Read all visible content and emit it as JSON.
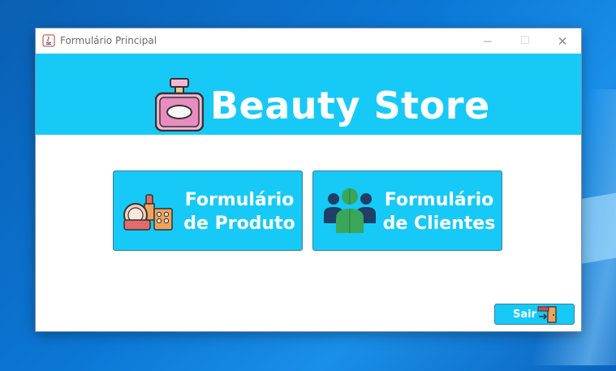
{
  "window": {
    "title": "Formulário Principal",
    "minimize": "—",
    "maximize": "☐",
    "close": "✕"
  },
  "header": {
    "title": "Beauty Store",
    "logo_icon": "perfume-bottle-icon"
  },
  "buttons": {
    "produto": {
      "line1": "Formulário",
      "line2": "de Produto",
      "icon": "makeup-kit-icon"
    },
    "clientes": {
      "line1": "Formulário",
      "line2": "de Clientes",
      "icon": "users-group-icon"
    },
    "sair": {
      "label": "Sair",
      "icon": "exit-door-icon"
    }
  },
  "colors": {
    "accent": "#17c9f6",
    "button_border": "#3f7f93",
    "text_on_accent": "#ffffff"
  }
}
